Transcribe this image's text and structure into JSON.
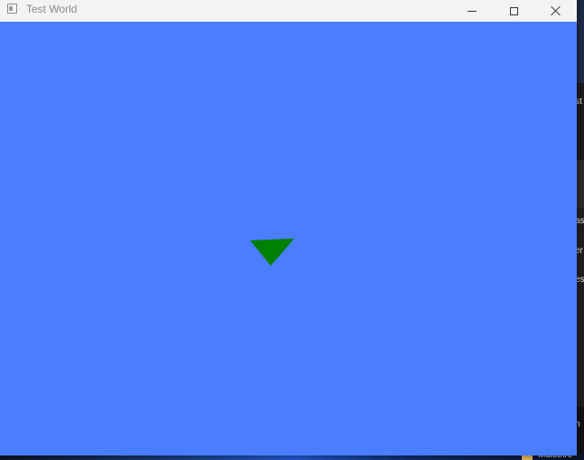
{
  "window": {
    "title": "Test World",
    "icon": "app-window-icon",
    "controls": {
      "minimize_icon": "minimize-icon",
      "maximize_icon": "maximize-icon",
      "close_icon": "close-icon"
    }
  },
  "viewport": {
    "background_color": "#4a7dff",
    "shape": {
      "type": "triangle",
      "fill": "#008000"
    }
  },
  "background": {
    "visible_fragments": [
      "st",
      "as",
      "er",
      "es",
      "n"
    ],
    "taskbar_folder_label": "Multithre"
  }
}
